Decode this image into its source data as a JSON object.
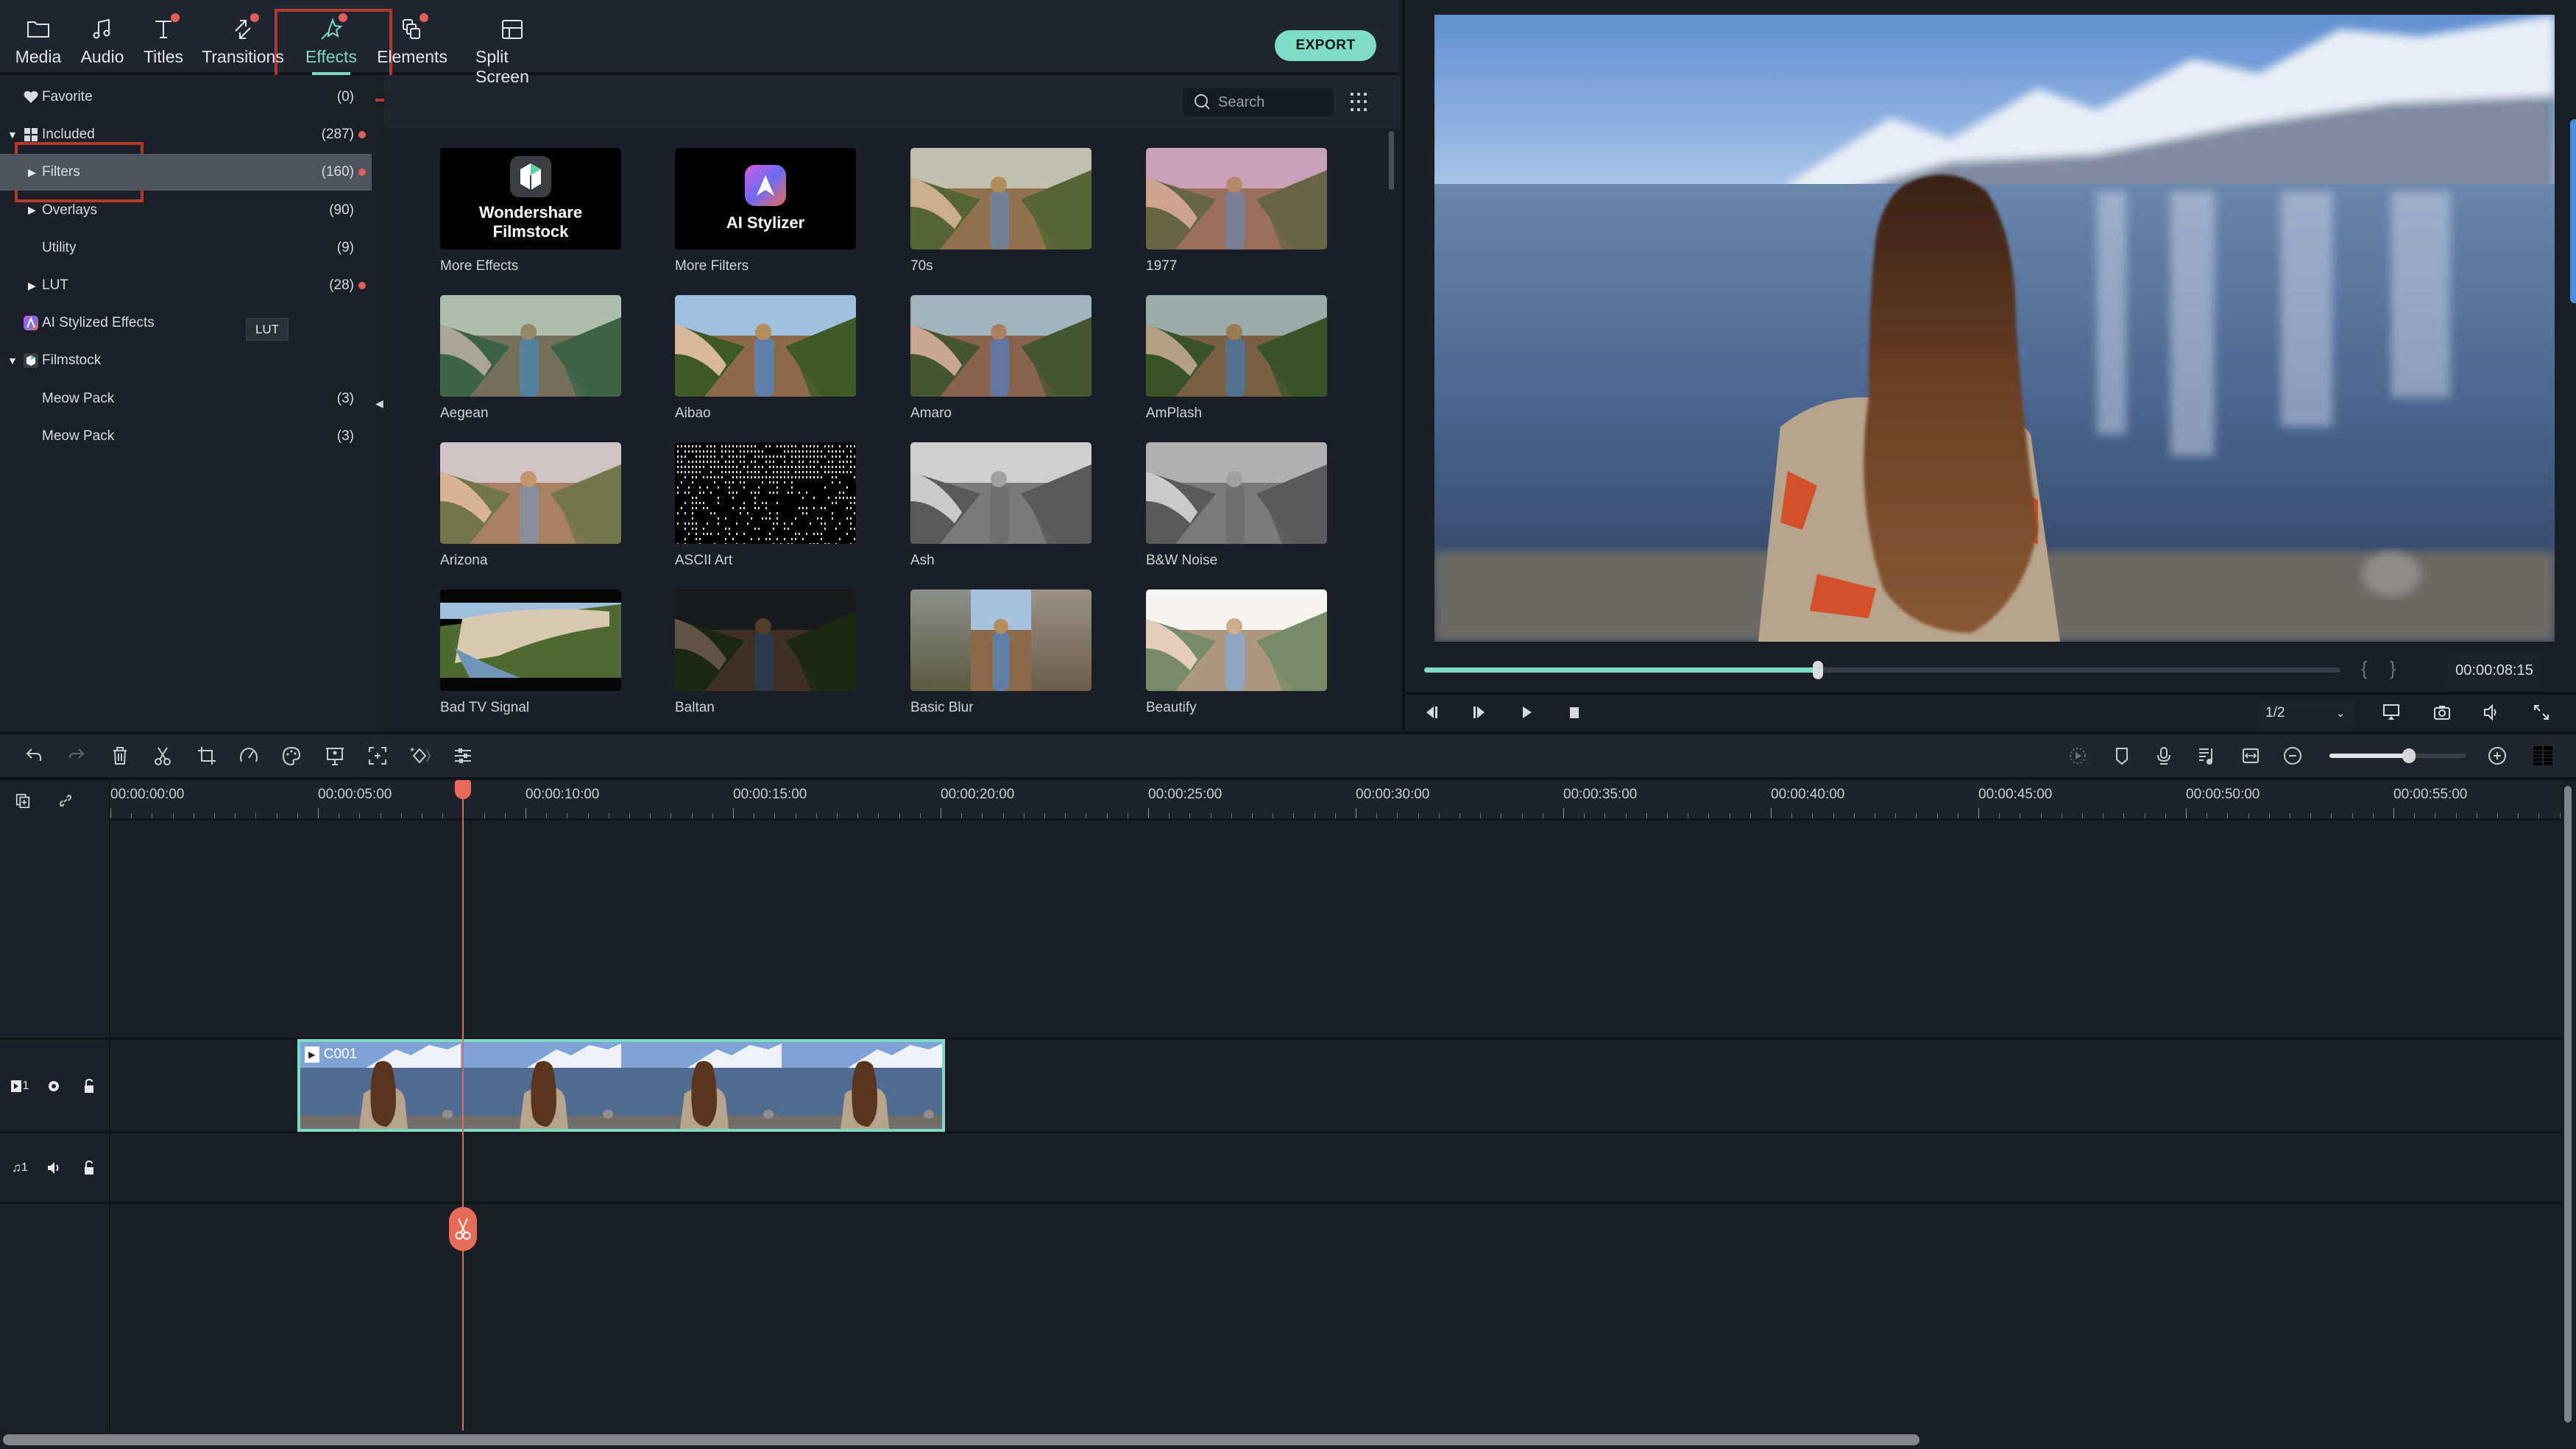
{
  "nav": {
    "tabs": [
      {
        "label": "Media",
        "icon": "folder-icon",
        "badge": false,
        "active": false
      },
      {
        "label": "Audio",
        "icon": "music-note-icon",
        "badge": false,
        "active": false
      },
      {
        "label": "Titles",
        "icon": "text-icon",
        "badge": true,
        "active": false
      },
      {
        "label": "Transitions",
        "icon": "transition-icon",
        "badge": true,
        "active": false
      },
      {
        "label": "Effects",
        "icon": "magic-wand-icon",
        "badge": true,
        "active": true
      },
      {
        "label": "Elements",
        "icon": "elements-icon",
        "badge": true,
        "active": false
      },
      {
        "label": "Split Screen",
        "icon": "split-screen-icon",
        "badge": false,
        "active": false
      }
    ],
    "export_label": "EXPORT"
  },
  "sidebar": {
    "items": [
      {
        "label": "Favorite",
        "count": "(0)",
        "icon": "heart-icon",
        "expander": "none",
        "dot": false,
        "selected": false
      },
      {
        "label": "Included",
        "count": "(287)",
        "icon": "grid-icon",
        "expander": "expanded",
        "dot": true,
        "selected": false
      },
      {
        "label": "Filters",
        "count": "(160)",
        "icon": "",
        "expander": "collapsed",
        "dot": true,
        "selected": true
      },
      {
        "label": "Overlays",
        "count": "(90)",
        "icon": "",
        "expander": "collapsed",
        "dot": false,
        "selected": false
      },
      {
        "label": "Utility",
        "count": "(9)",
        "icon": "",
        "expander": "none",
        "dot": false,
        "selected": false
      },
      {
        "label": "LUT",
        "count": "(28)",
        "icon": "",
        "expander": "collapsed",
        "dot": true,
        "selected": false
      },
      {
        "label": "AI Stylized Effects",
        "count": "",
        "icon": "ai-stylizer-icon",
        "expander": "none",
        "dot": false,
        "selected": false
      },
      {
        "label": "Filmstock",
        "count": "",
        "icon": "filmstock-icon",
        "expander": "expanded",
        "dot": false,
        "selected": false
      },
      {
        "label": "Meow Pack",
        "count": "(3)",
        "icon": "",
        "expander": "none",
        "dot": false,
        "selected": false
      },
      {
        "label": "Meow Pack",
        "count": "(3)",
        "icon": "",
        "expander": "none",
        "dot": false,
        "selected": false
      }
    ],
    "tooltip": "LUT"
  },
  "grid": {
    "search_placeholder": "Search",
    "items": [
      {
        "name": "More Effects",
        "promo": "Wondershare Filmstock",
        "style": "filmstock"
      },
      {
        "name": "More Filters",
        "promo": "AI Stylizer",
        "style": "aistylizer"
      },
      {
        "name": "70s",
        "style": "warm"
      },
      {
        "name": "1977",
        "style": "pink"
      },
      {
        "name": "Aegean",
        "style": "teal"
      },
      {
        "name": "Aibao",
        "style": "natural"
      },
      {
        "name": "Amaro",
        "style": "vivid"
      },
      {
        "name": "AmPlash",
        "style": "muted"
      },
      {
        "name": "Arizona",
        "style": "faded"
      },
      {
        "name": "ASCII Art",
        "style": "ascii"
      },
      {
        "name": "Ash",
        "style": "gray"
      },
      {
        "name": "B&W Noise",
        "style": "noise"
      },
      {
        "name": "Bad TV Signal",
        "style": "badtv"
      },
      {
        "name": "Baltan",
        "style": "dark"
      },
      {
        "name": "Basic Blur",
        "style": "blur"
      },
      {
        "name": "Beautify",
        "style": "bright"
      }
    ]
  },
  "preview": {
    "timecode": "00:00:08:15",
    "progress": 0.43,
    "ratio": "1/2"
  },
  "timeline": {
    "ruler_labels": [
      "00:00:00:00",
      "00:00:05:00",
      "00:00:10:00",
      "00:00:15:00",
      "00:00:20:00",
      "00:00:25:00",
      "00:00:30:00",
      "00:00:35:00",
      "00:00:40:00",
      "00:00:45:00",
      "00:00:50:00",
      "00:00:55:00"
    ],
    "playhead_seconds": 8.5,
    "zoom_level": 0.58,
    "clip": {
      "name": "C001",
      "start_seconds": 4.5,
      "end_seconds": 20.1
    },
    "video_track": "1",
    "audio_track": "1"
  },
  "colors": {
    "accent": "#7edcc4",
    "badge": "#e0605a",
    "playhead": "#e86a58",
    "highlight_box": "#b3392d"
  }
}
